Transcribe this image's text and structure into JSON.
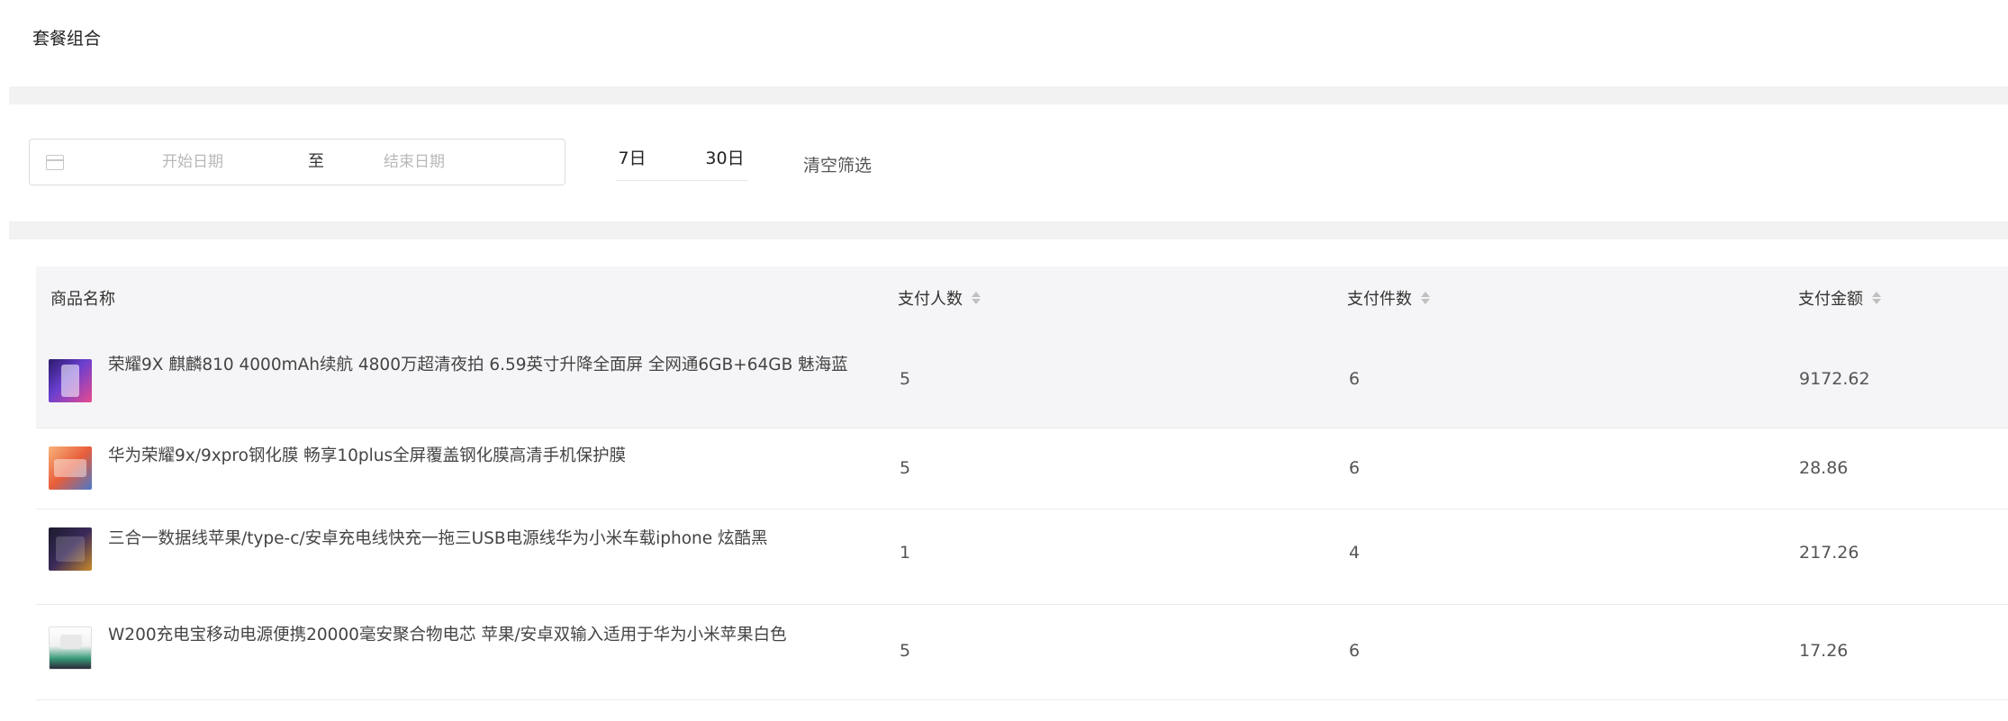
{
  "header": {
    "title": "套餐组合"
  },
  "filter": {
    "start_placeholder": "开始日期",
    "separator": "至",
    "end_placeholder": "结束日期",
    "quick_ranges": [
      "7日",
      "30日"
    ],
    "clear_label": "清空筛选"
  },
  "table": {
    "columns": {
      "name": "商品名称",
      "payers": "支付人数",
      "items": "支付件数",
      "amount": "支付金额"
    },
    "rows": [
      {
        "name": "荣耀9X 麒麟810 4000mAh续航 4800万超清夜拍 6.59英寸升降全面屏 全网通6GB+64GB 魅海蓝",
        "payers": "5",
        "items": "6",
        "amount": "9172.62"
      },
      {
        "name": "华为荣耀9x/9xpro钢化膜 畅享10plus全屏覆盖钢化膜高清手机保护膜",
        "payers": "5",
        "items": "6",
        "amount": "28.86"
      },
      {
        "name": "三合一数据线苹果/type-c/安卓充电线快充一拖三USB电源线华为小米车载iphone 炫酷黑",
        "payers": "1",
        "items": "4",
        "amount": "217.26"
      },
      {
        "name": "W200充电宝移动电源便携20000毫安聚合物电芯 苹果/安卓双输入适用于华为小米苹果白色",
        "payers": "5",
        "items": "6",
        "amount": "17.26"
      }
    ]
  }
}
